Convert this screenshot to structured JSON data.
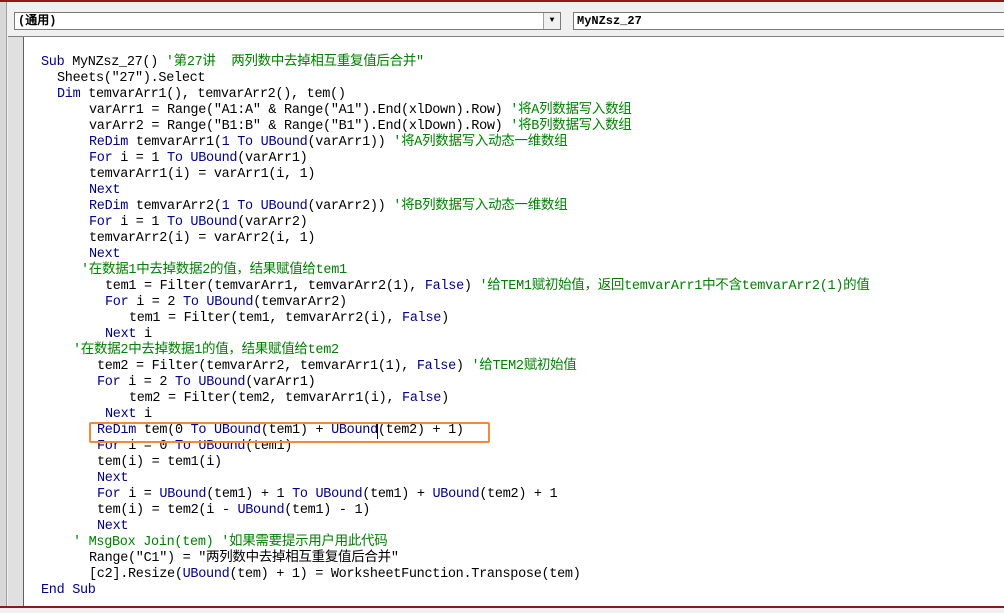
{
  "toolbar": {
    "object_combo": "(通用)",
    "procedure_combo": "MyNZsz_27",
    "dropdown_icon": "chevron-down-icon"
  },
  "colors": {
    "keyword": "#00008b",
    "comment": "#008000",
    "highlight": "#f08a3c"
  },
  "code": [
    [
      [
        "kw",
        "Sub"
      ],
      [
        "tx",
        " MyNZsz_27() "
      ],
      [
        "cm",
        "'第27讲  两列数中去掉相互重复值后合并\""
      ]
    ],
    [
      [
        "tx",
        "Sheets(\"27\").Select"
      ]
    ],
    [
      [
        "kw",
        "Dim"
      ],
      [
        "tx",
        " temvarArr1(), temvarArr2(), tem()"
      ]
    ],
    [
      [
        "tx",
        "varArr1 = Range(\"A1:A\" & Range(\"A1\").End(xlDown).Row) "
      ],
      [
        "cm",
        "'将A列数据写入数组"
      ]
    ],
    [
      [
        "tx",
        "varArr2 = Range(\"B1:B\" & Range(\"B1\").End(xlDown).Row) "
      ],
      [
        "cm",
        "'将B列数据写入数组"
      ]
    ],
    [
      [
        "kw",
        "ReDim"
      ],
      [
        "tx",
        " temvarArr1("
      ],
      [
        "kw",
        "1 To UBound"
      ],
      [
        "tx",
        "(varArr1)) "
      ],
      [
        "cm",
        "'将A列数据写入动态一维数组"
      ]
    ],
    [
      [
        "kw",
        "For"
      ],
      [
        "tx",
        " i = 1 "
      ],
      [
        "kw",
        "To UBound"
      ],
      [
        "tx",
        "(varArr1)"
      ]
    ],
    [
      [
        "tx",
        "temvarArr1(i) = varArr1(i, 1)"
      ]
    ],
    [
      [
        "kw",
        "Next"
      ]
    ],
    [
      [
        "kw",
        "ReDim"
      ],
      [
        "tx",
        " temvarArr2("
      ],
      [
        "kw",
        "1 To UBound"
      ],
      [
        "tx",
        "(varArr2)) "
      ],
      [
        "cm",
        "'将B列数据写入动态一维数组"
      ]
    ],
    [
      [
        "kw",
        "For"
      ],
      [
        "tx",
        " i = 1 "
      ],
      [
        "kw",
        "To UBound"
      ],
      [
        "tx",
        "(varArr2)"
      ]
    ],
    [
      [
        "tx",
        "temvarArr2(i) = varArr2(i, 1)"
      ]
    ],
    [
      [
        "kw",
        "Next"
      ]
    ],
    [
      [
        "cm",
        "'在数据1中去掉数据2的值，结果赋值给tem1"
      ]
    ],
    [
      [
        "tx",
        "tem1 = Filter(temvarArr1, temvarArr2(1), "
      ],
      [
        "kw",
        "False"
      ],
      [
        "tx",
        ") "
      ],
      [
        "cm",
        "'给TEM1赋初始值，返回temvarArr1中不含temvarArr2(1)的值"
      ]
    ],
    [
      [
        "kw",
        "For"
      ],
      [
        "tx",
        " i = 2 "
      ],
      [
        "kw",
        "To UBound"
      ],
      [
        "tx",
        "(temvarArr2)"
      ]
    ],
    [
      [
        "tx",
        "tem1 = Filter(tem1, temvarArr2(i), "
      ],
      [
        "kw",
        "False"
      ],
      [
        "tx",
        ")"
      ]
    ],
    [
      [
        "kw",
        "Next"
      ],
      [
        "tx",
        " i"
      ]
    ],
    [
      [
        "cm",
        "'在数据2中去掉数据1的值，结果赋值给tem2"
      ]
    ],
    [
      [
        "tx",
        "tem2 = Filter(temvarArr2, temvarArr1(1), "
      ],
      [
        "kw",
        "False"
      ],
      [
        "tx",
        ") "
      ],
      [
        "cm",
        "'给TEM2赋初始值"
      ]
    ],
    [
      [
        "kw",
        "For"
      ],
      [
        "tx",
        " i = 2 "
      ],
      [
        "kw",
        "To UBound"
      ],
      [
        "tx",
        "(varArr1)"
      ]
    ],
    [
      [
        "tx",
        "tem2 = Filter(tem2, temvarArr1(i), "
      ],
      [
        "kw",
        "False"
      ],
      [
        "tx",
        ")"
      ]
    ],
    [
      [
        "kw",
        "Next"
      ],
      [
        "tx",
        " i"
      ]
    ],
    [
      [
        "kw",
        "ReDim"
      ],
      [
        "tx",
        " tem(0 "
      ],
      [
        "kw",
        "To UBound"
      ],
      [
        "tx",
        "(tem1) + "
      ],
      [
        "kw",
        "UBound"
      ],
      [
        "tx",
        "(tem2) + 1)"
      ]
    ],
    [
      [
        "kw",
        "For"
      ],
      [
        "tx",
        " i = 0 "
      ],
      [
        "kw",
        "To UBound"
      ],
      [
        "tx",
        "(tem1)"
      ]
    ],
    [
      [
        "tx",
        "tem(i) = tem1(i)"
      ]
    ],
    [
      [
        "kw",
        "Next"
      ]
    ],
    [
      [
        "kw",
        "For"
      ],
      [
        "tx",
        " i = "
      ],
      [
        "kw",
        "UBound"
      ],
      [
        "tx",
        "(tem1) + 1 "
      ],
      [
        "kw",
        "To UBound"
      ],
      [
        "tx",
        "(tem1) + "
      ],
      [
        "kw",
        "UBound"
      ],
      [
        "tx",
        "(tem2) + 1"
      ]
    ],
    [
      [
        "tx",
        "tem(i) = tem2(i - "
      ],
      [
        "kw",
        "UBound"
      ],
      [
        "tx",
        "(tem1) - 1)"
      ]
    ],
    [
      [
        "kw",
        "Next"
      ]
    ],
    [
      [
        "cm",
        "' MsgBox Join(tem) '如果需要提示用户用此代码"
      ]
    ],
    [
      [
        "tx",
        "Range(\"C1\") = \"两列数中去掉相互重复值后合并\""
      ]
    ],
    [
      [
        "tx",
        "[c2].Resize("
      ],
      [
        "kw",
        "UBound"
      ],
      [
        "tx",
        "(tem) + 1) = WorksheetFunction.Transpose(tem)"
      ]
    ],
    [
      [
        "kw",
        "End Sub"
      ]
    ]
  ]
}
